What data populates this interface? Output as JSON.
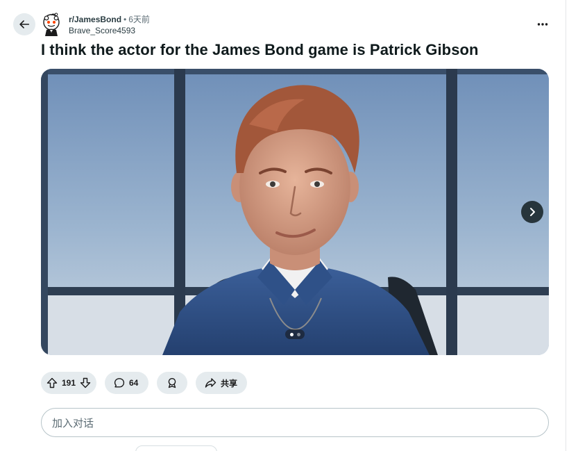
{
  "post": {
    "subreddit": "r/JamesBond",
    "separator": "•",
    "age": "6天前",
    "author": "Brave_Score4593",
    "title": "I think the actor for the James Bond game is Patrick Gibson"
  },
  "media": {
    "gallery_current": 1,
    "gallery_total": 2
  },
  "actions": {
    "score": "191",
    "comments": "64",
    "share_label": "共享"
  },
  "comment_input": {
    "placeholder": "加入对话"
  },
  "icons": {
    "back": "arrow-left-icon",
    "avatar": "reddit-snoo-avatar",
    "more": "ellipsis-icon",
    "next": "chevron-right-icon",
    "upvote": "arrow-up-icon",
    "downvote": "arrow-down-icon",
    "comment": "speech-bubble-icon",
    "award": "award-icon",
    "share": "share-arrow-icon"
  },
  "colors": {
    "pill_bg": "#e5ebee",
    "title_text": "#0f1a1c",
    "meta_text": "#5c6c74"
  }
}
